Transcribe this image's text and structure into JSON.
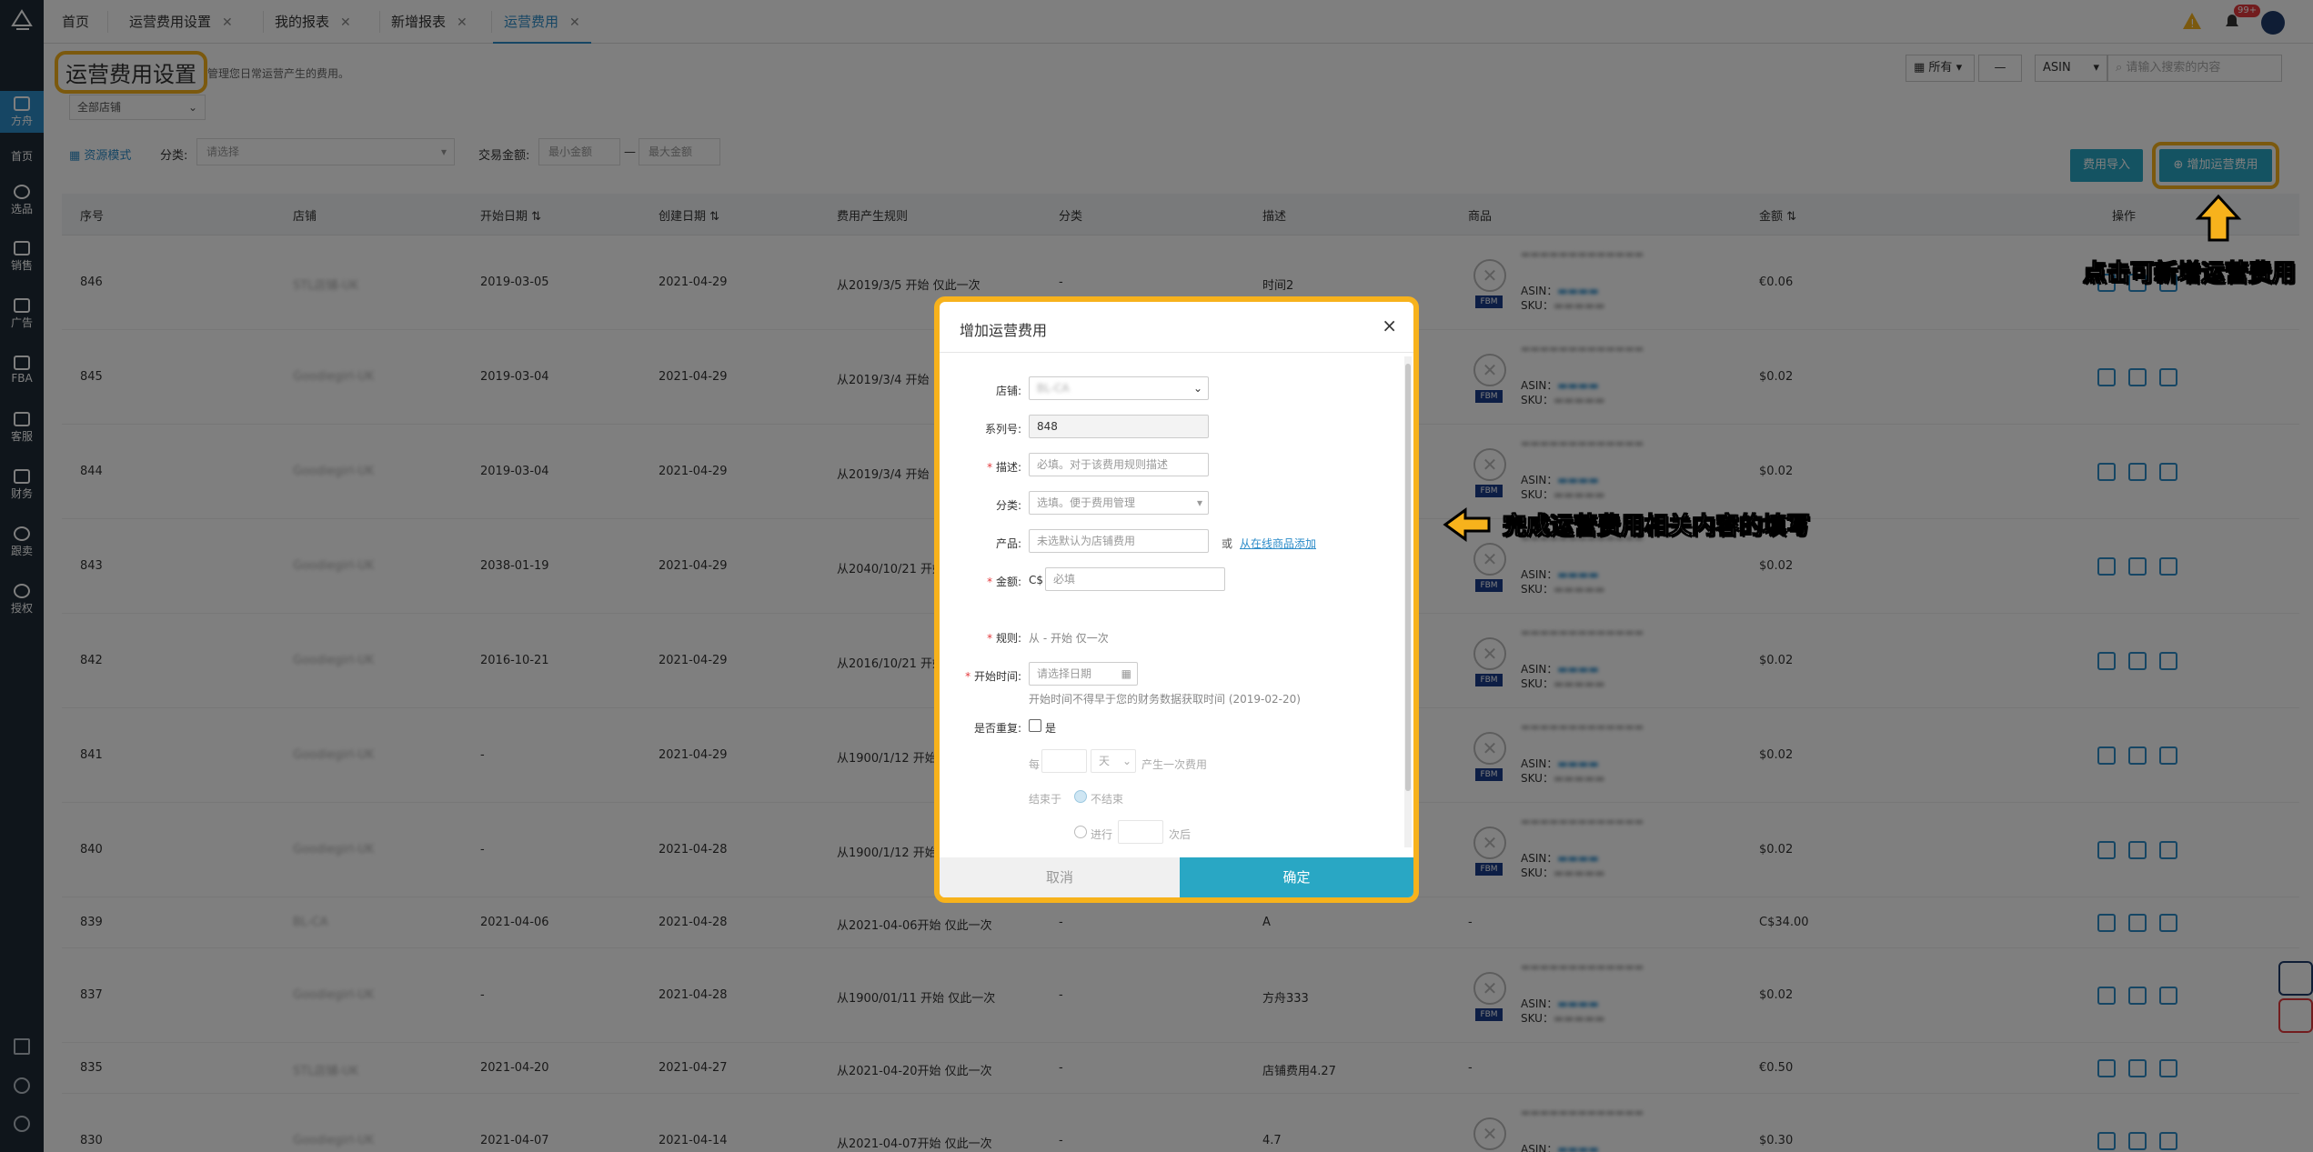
{
  "tabs": [
    {
      "label": "首页",
      "closable": false
    },
    {
      "label": "运营费用设置",
      "closable": true
    },
    {
      "label": "我的报表",
      "closable": true
    },
    {
      "label": "新增报表",
      "closable": true
    },
    {
      "label": "运营费用",
      "closable": true,
      "active": true
    }
  ],
  "header": {
    "notif_badge": "99+"
  },
  "sidebar": {
    "items": [
      {
        "label": "方舟",
        "icon": "home-icon"
      },
      {
        "label": "首页",
        "icon": "home-icon"
      },
      {
        "label": "选品",
        "icon": "search-icon"
      },
      {
        "label": "销售",
        "icon": "chart-icon"
      },
      {
        "label": "广告",
        "icon": "ad-icon"
      },
      {
        "label": "FBA",
        "icon": "box-icon"
      },
      {
        "label": "客服",
        "icon": "service-icon"
      },
      {
        "label": "财务",
        "icon": "finance-icon"
      },
      {
        "label": "跟卖",
        "icon": "pie-icon"
      },
      {
        "label": "授权",
        "icon": "auth-icon"
      }
    ]
  },
  "page": {
    "title": "运营费用设置",
    "subtitle": "管理您日常运营产生的费用。",
    "store_filter": "全部店铺",
    "scope": "所有",
    "scope_dash": "—",
    "search_type": "ASIN",
    "search_placeholder": "请输入搜索的内容"
  },
  "toolbar": {
    "view_mode": "资源模式",
    "category_label": "分类:",
    "category_placeholder": "请选择",
    "amount_label": "交易金额:",
    "min_placeholder": "最小金额",
    "dash": "—",
    "max_placeholder": "最大金额",
    "import_button": "费用导入",
    "add_button": "增加运营费用"
  },
  "table": {
    "headers": [
      "序号",
      "店铺",
      "开始日期",
      "创建日期",
      "费用产生规则",
      "分类",
      "描述",
      "商品",
      "金额",
      "操作"
    ],
    "product_asin_label": "ASIN：",
    "product_sku_label": "SKU：",
    "rows": [
      {
        "id": "846",
        "store": "STL店铺-UK",
        "start": "2019-03-05",
        "created": "2021-04-29",
        "rule": "从2019/3/5 开始 仅此一次",
        "category": "-",
        "desc": "时间2",
        "has_product": true,
        "amount": "€0.06"
      },
      {
        "id": "845",
        "store": "Goodiegirl-UK",
        "start": "2019-03-04",
        "created": "2021-04-29",
        "rule": "从2019/3/4 开始",
        "category": "-",
        "desc": "",
        "has_product": true,
        "amount": "$0.02"
      },
      {
        "id": "844",
        "store": "Goodiegirl-UK",
        "start": "2019-03-04",
        "created": "2021-04-29",
        "rule": "从2019/3/4 开始",
        "category": "-",
        "desc": "",
        "has_product": true,
        "amount": "$0.02"
      },
      {
        "id": "843",
        "store": "Goodiegirl-UK",
        "start": "2038-01-19",
        "created": "2021-04-29",
        "rule": "从2040/10/21 开始",
        "category": "-",
        "desc": "",
        "has_product": true,
        "amount": "$0.02"
      },
      {
        "id": "842",
        "store": "Goodiegirl-UK",
        "start": "2016-10-21",
        "created": "2021-04-29",
        "rule": "从2016/10/21 开始",
        "category": "-",
        "desc": "",
        "has_product": true,
        "amount": "$0.02"
      },
      {
        "id": "841",
        "store": "Goodiegirl-UK",
        "start": "-",
        "created": "2021-04-29",
        "rule": "从1900/1/12 开始",
        "category": "-",
        "desc": "",
        "has_product": true,
        "amount": "$0.02"
      },
      {
        "id": "840",
        "store": "Goodiegirl-UK",
        "start": "-",
        "created": "2021-04-28",
        "rule": "从1900/1/12 开始",
        "category": "-",
        "desc": "",
        "has_product": true,
        "amount": "$0.02"
      },
      {
        "id": "839",
        "store": "BL-CA",
        "start": "2021-04-06",
        "created": "2021-04-28",
        "rule": "从2021-04-06开始 仅此一次",
        "category": "-",
        "desc": "A",
        "has_product": false,
        "amount": "C$34.00"
      },
      {
        "id": "837",
        "store": "Goodiegirl-UK",
        "start": "-",
        "created": "2021-04-28",
        "rule": "从1900/01/11 开始 仅此一次",
        "category": "-",
        "desc": "方舟333",
        "has_product": true,
        "amount": "$0.02"
      },
      {
        "id": "835",
        "store": "STL店铺-UK",
        "start": "2021-04-20",
        "created": "2021-04-27",
        "rule": "从2021-04-20开始 仅此一次",
        "category": "-",
        "desc": "店铺费用4.27",
        "has_product": false,
        "amount": "€0.50"
      },
      {
        "id": "830",
        "store": "Goodiegirl-UK",
        "start": "2021-04-07",
        "created": "2021-04-14",
        "rule": "从2021-04-07开始 仅此一次",
        "category": "-",
        "desc": "4.7",
        "has_product": true,
        "amount": "$0.30"
      }
    ]
  },
  "modal": {
    "title": "增加运营费用",
    "close": "×",
    "store_label": "店铺:",
    "store_value": "BL-CA",
    "serial_label": "系列号:",
    "serial_value": "848",
    "desc_label": "描述:",
    "desc_placeholder": "必填。对于该费用规则描述",
    "category_label": "分类:",
    "category_placeholder": "选填。便于费用管理",
    "product_label": "产品:",
    "product_placeholder": "未选默认为店铺费用",
    "product_or": "或",
    "product_link": "从在线商品添加",
    "amount_label": "金额:",
    "currency": "C$",
    "amount_placeholder": "必填",
    "rule_label": "规则:",
    "rule_text": "从 - 开始   仅一次",
    "start_label": "开始时间:",
    "start_placeholder": "请选择日期",
    "start_hint": "开始时间不得早于您的财务数据获取时间 (2019-02-20)",
    "repeat_label": "是否重复:",
    "repeat_option": "是",
    "every_label": "每",
    "unit_value": "天",
    "every_suffix": "产生一次费用",
    "end_label": "结束于",
    "never_end": "不结束",
    "run_label": "进行",
    "times_suffix": "次后",
    "cancel_button": "取消",
    "ok_button": "确定"
  },
  "annotations": {
    "add_hint": "点击可新增运营费用",
    "fill_hint": "完成运营费用相关内容的填写"
  }
}
